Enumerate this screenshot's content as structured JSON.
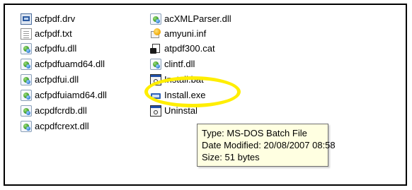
{
  "files": {
    "column1": [
      {
        "name": "acfpdf.drv",
        "icon": "driver-file-icon",
        "icon_class": "ico-drv"
      },
      {
        "name": "acfpdf.txt",
        "icon": "text-file-icon",
        "icon_class": "ico-txt"
      },
      {
        "name": "acfpdfu.dll",
        "icon": "dll-file-icon",
        "icon_class": "ico-dll"
      },
      {
        "name": "acfpdfuamd64.dll",
        "icon": "dll-file-icon",
        "icon_class": "ico-dll"
      },
      {
        "name": "acfpdfui.dll",
        "icon": "dll-file-icon",
        "icon_class": "ico-dll"
      },
      {
        "name": "acfpdfuiamd64.dll",
        "icon": "dll-file-icon",
        "icon_class": "ico-dll"
      },
      {
        "name": "acpdfcrdb.dll",
        "icon": "dll-file-icon",
        "icon_class": "ico-dll"
      },
      {
        "name": "acpdfcrext.dll",
        "icon": "dll-file-icon",
        "icon_class": "ico-dll"
      }
    ],
    "column2": [
      {
        "name": "acXMLParser.dll",
        "icon": "dll-file-icon",
        "icon_class": "ico-dll"
      },
      {
        "name": "amyuni.inf",
        "icon": "setup-info-file-icon",
        "icon_class": "ico-inf"
      },
      {
        "name": "atpdf300.cat",
        "icon": "security-catalog-file-icon",
        "icon_class": "ico-cat"
      },
      {
        "name": "clintf.dll",
        "icon": "dll-file-icon",
        "icon_class": "ico-dll"
      },
      {
        "name": "Install.bat",
        "icon": "batch-file-icon",
        "icon_class": "ico-bat"
      },
      {
        "name": "Install.exe",
        "icon": "executable-file-icon",
        "icon_class": "ico-exe"
      },
      {
        "name": "Uninstall.bat",
        "icon": "batch-file-icon",
        "icon_class": "ico-bat"
      }
    ]
  },
  "tooltip": {
    "type": "Type: MS-DOS Batch File",
    "modified": "Date Modified: 20/08/2007 08:58",
    "size": "Size: 51 bytes"
  },
  "colors": {
    "highlight": "#ffee00",
    "tooltip_background": "#ffffe1"
  }
}
